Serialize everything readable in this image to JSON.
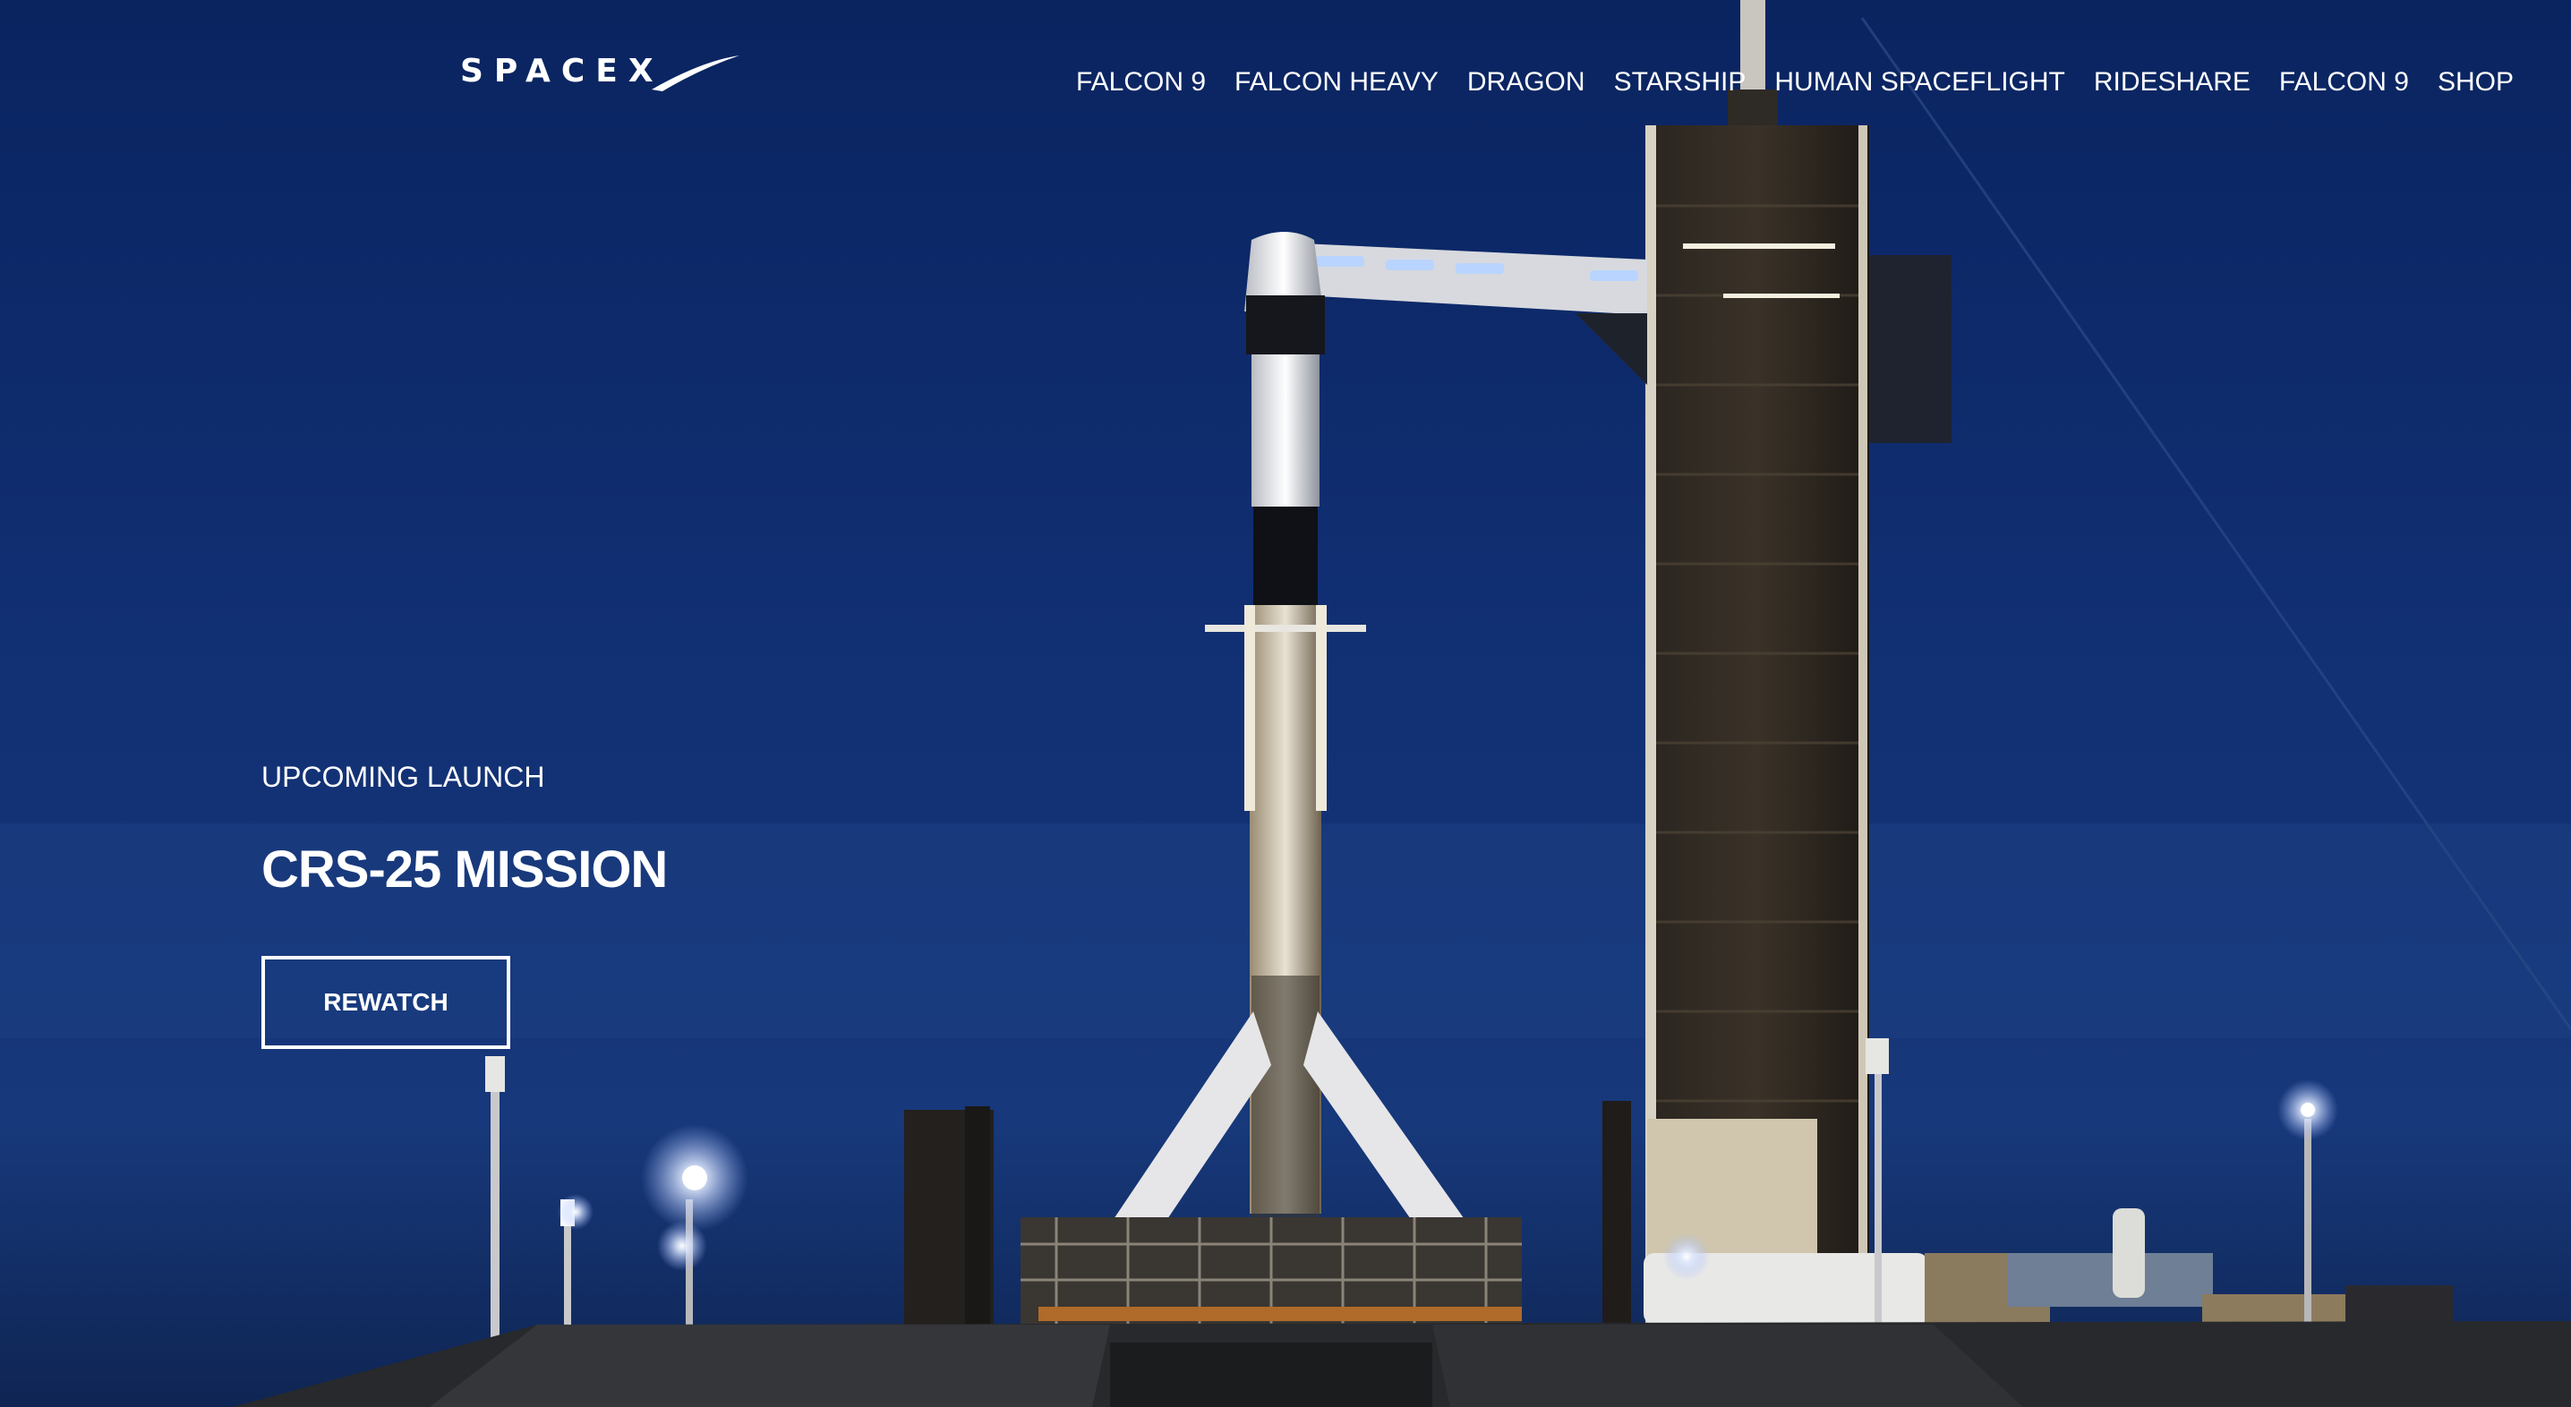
{
  "header": {
    "logo_text": "SPACEX",
    "nav": [
      {
        "label": "FALCON 9"
      },
      {
        "label": "FALCON HEAVY"
      },
      {
        "label": "DRAGON"
      },
      {
        "label": "STARSHIP"
      },
      {
        "label": "HUMAN SPACEFLIGHT"
      },
      {
        "label": "RIDESHARE"
      },
      {
        "label": "FALCON 9"
      },
      {
        "label": "SHOP"
      }
    ]
  },
  "hero": {
    "eyebrow": "UPCOMING LAUNCH",
    "title": "CRS-25 MISSION",
    "button_label": "REWATCH",
    "image_subject": "Falcon 9 rocket with Dragon capsule on launch pad beside service tower at dusk"
  },
  "colors": {
    "sky_top": "#0a2460",
    "sky_mid": "#12357e",
    "sky_low": "#1a3f7f",
    "text": "#ffffff"
  }
}
